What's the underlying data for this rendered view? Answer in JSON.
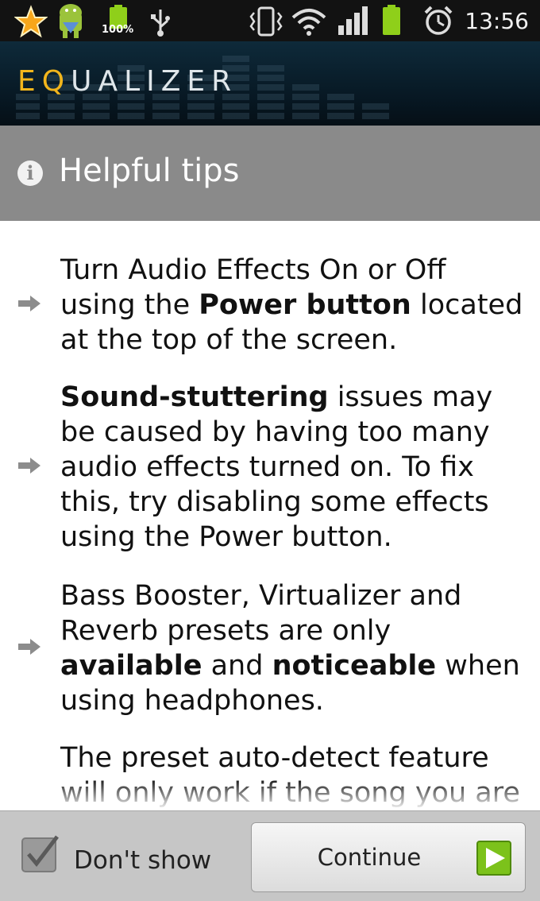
{
  "status_bar": {
    "battery_percent_label": "100%",
    "time": "13:56",
    "icons": [
      "star-icon",
      "android-icon",
      "battery-icon",
      "usb-icon",
      "vibrate-icon",
      "wifi-icon",
      "signal-icon",
      "battery-icon",
      "alarm-icon"
    ]
  },
  "app": {
    "title_first": "E",
    "title_second": "Q",
    "title_rest": "UALIZER",
    "accent_color": "#f2b51c"
  },
  "dialog": {
    "title": "Helpful tips",
    "tips": [
      {
        "parts": [
          {
            "text": " Turn Audio Effects On or Off using the ",
            "bold": false
          },
          {
            "text": "Power button",
            "bold": true
          },
          {
            "text": " located at the top of the screen.",
            "bold": false
          }
        ]
      },
      {
        "parts": [
          {
            "text": " ",
            "bold": false
          },
          {
            "text": "Sound-stuttering",
            "bold": true
          },
          {
            "text": " issues may be caused by having too many audio effects turned on. To fix this, try disabling some effects using the Power button.",
            "bold": false
          }
        ]
      },
      {
        "parts": [
          {
            "text": " Bass Booster, Virtualizer and Reverb presets are only ",
            "bold": false
          },
          {
            "text": "available",
            "bold": true
          },
          {
            "text": " and ",
            "bold": false
          },
          {
            "text": "noticeable",
            "bold": true
          },
          {
            "text": " when using headphones.",
            "bold": false
          }
        ]
      },
      {
        "parts": [
          {
            "text": " The preset auto-detect feature will only work if the song you are",
            "bold": false
          }
        ]
      }
    ]
  },
  "footer": {
    "checkbox_label": "Don't show",
    "checkbox_checked": true,
    "continue_label": "Continue"
  }
}
